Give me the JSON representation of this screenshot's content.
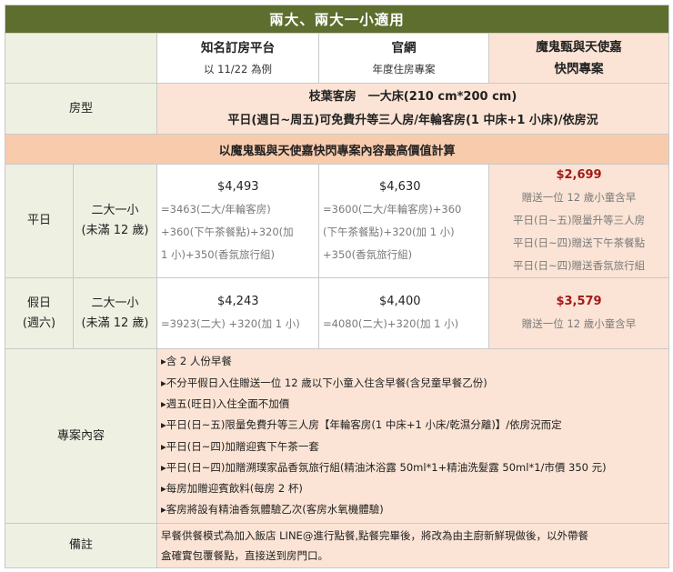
{
  "title": "兩大、兩大一小適用",
  "columns": [
    {
      "title": "知名訂房平台",
      "subtitle": "以 11/22 為例"
    },
    {
      "title": "官網",
      "subtitle": "年度住房專案"
    },
    {
      "title": "魔鬼甄與天使嘉",
      "subtitle": "快閃專案"
    }
  ],
  "room_type": {
    "label": "房型",
    "line1": "枝葉客房　一大床(210 cm*200 cm)",
    "line2": "平日(週日~周五)可免費升等三人房/年輪客房(1 中床+1 小床)/依房況"
  },
  "calc_note": "以魔鬼甄與天使嘉快閃專案內容最高價值計算",
  "weekday": {
    "label": "平日",
    "guests_line1": "二大一小",
    "guests_line2": "(未滿 12 歲)",
    "platform_price": "$4,493",
    "platform_details": [
      "=3463(二大/年輪客房)",
      "+360(下午茶餐點)+320(加",
      "1 小)+350(香氛旅行組)"
    ],
    "official_price": "$4,630",
    "official_details": [
      "=3600(二大/年輪客房)+360",
      "(下午茶餐點)+320(加 1 小)",
      "+350(香氛旅行組)"
    ],
    "flash_price": "$2,699",
    "flash_details": [
      "贈送一位 12 歲小童含早",
      "平日(日~五)限量升等三人房",
      "平日(日~四)贈送下午茶餐點",
      "平日(日~四)贈送香氛旅行組"
    ]
  },
  "holiday": {
    "label_line1": "假日",
    "label_line2": "(週六)",
    "guests_line1": "二大一小",
    "guests_line2": "(未滿 12 歲)",
    "platform_price": "$4,243",
    "platform_detail": "=3923(二大) +320(加 1 小)",
    "official_price": "$4,400",
    "official_detail": "=4080(二大)+320(加 1 小)",
    "flash_price": "$3,579",
    "flash_detail": "贈送一位 12 歲小童含早"
  },
  "plan": {
    "label": "專案內容",
    "items": [
      "▸含 2 人份早餐",
      "▸不分平假日入住贈送一位 12 歲以下小童入住含早餐(含兒童早餐乙份)",
      "▸週五(旺日)入住全面不加價",
      "▸平日(日~五)限量免費升等三人房【年輪客房(1 中床+1 小床/乾濕分離)】/依房況而定",
      "▸平日(日~四)加贈迎賓下午茶一套",
      "▸平日(日~四)加贈溯璞家品香氛旅行組(精油沐浴露 50ml*1+精油洗髮露 50ml*1/市價 350 元)",
      "▸每房加贈迎賓飲料(每房 2 杯)",
      "▸客房將設有精油香氛體驗乙次(客房水氧機體驗)"
    ]
  },
  "remark": {
    "label": "備註",
    "line1": "早餐供餐模式為加入飯店 LINE@進行點餐,點餐完畢後，將改為由主廚新鮮現做後，以外帶餐",
    "line2": "盒確實包覆餐點，直接送到房門口。"
  }
}
